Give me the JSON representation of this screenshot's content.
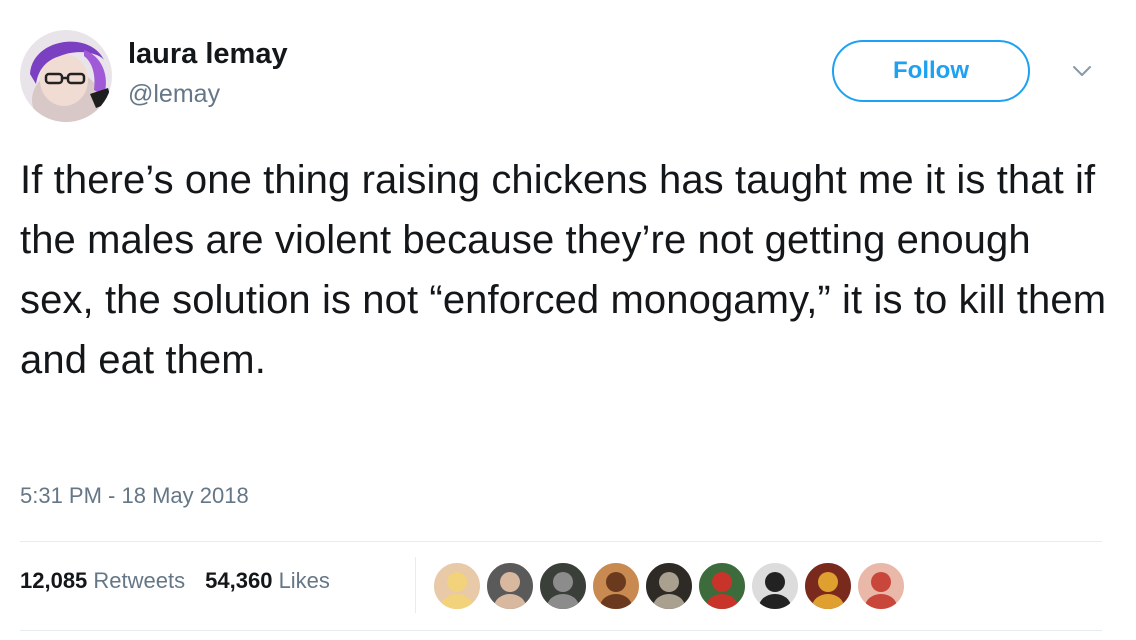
{
  "author": {
    "display_name": "laura lemay",
    "handle": "@lemay"
  },
  "follow_label": "Follow",
  "tweet": {
    "text": "If there’s one thing raising chickens has taught me it is that if the males are violent because they’re not getting enough sex, the solution is not “enforced monogamy,” it is to kill them and eat them.",
    "timestamp": "5:31 PM - 18 May 2018"
  },
  "stats": {
    "retweets_count": "12,085",
    "retweets_label": "Retweets",
    "likes_count": "54,360",
    "likes_label": "Likes"
  },
  "colors": {
    "accent": "#1da1f2",
    "secondary_text": "#657786",
    "primary_text": "#14171a",
    "divider": "#e6ecf0"
  },
  "icons": {
    "more": "chevron-down-icon"
  },
  "liker_avatars": [
    {
      "bg": "#e8c9a8",
      "fg": "#f2d27a"
    },
    {
      "bg": "#5a5a5a",
      "fg": "#d9b8a0"
    },
    {
      "bg": "#3a3f3a",
      "fg": "#8c8c8c"
    },
    {
      "bg": "#c98a52",
      "fg": "#6b3a1e"
    },
    {
      "bg": "#2e2a26",
      "fg": "#a9a090"
    },
    {
      "bg": "#3c6b3c",
      "fg": "#c8342a"
    },
    {
      "bg": "#dcdcdc",
      "fg": "#222222"
    },
    {
      "bg": "#7a2a1c",
      "fg": "#e0a030"
    },
    {
      "bg": "#e9b8a8",
      "fg": "#c8463a"
    }
  ]
}
